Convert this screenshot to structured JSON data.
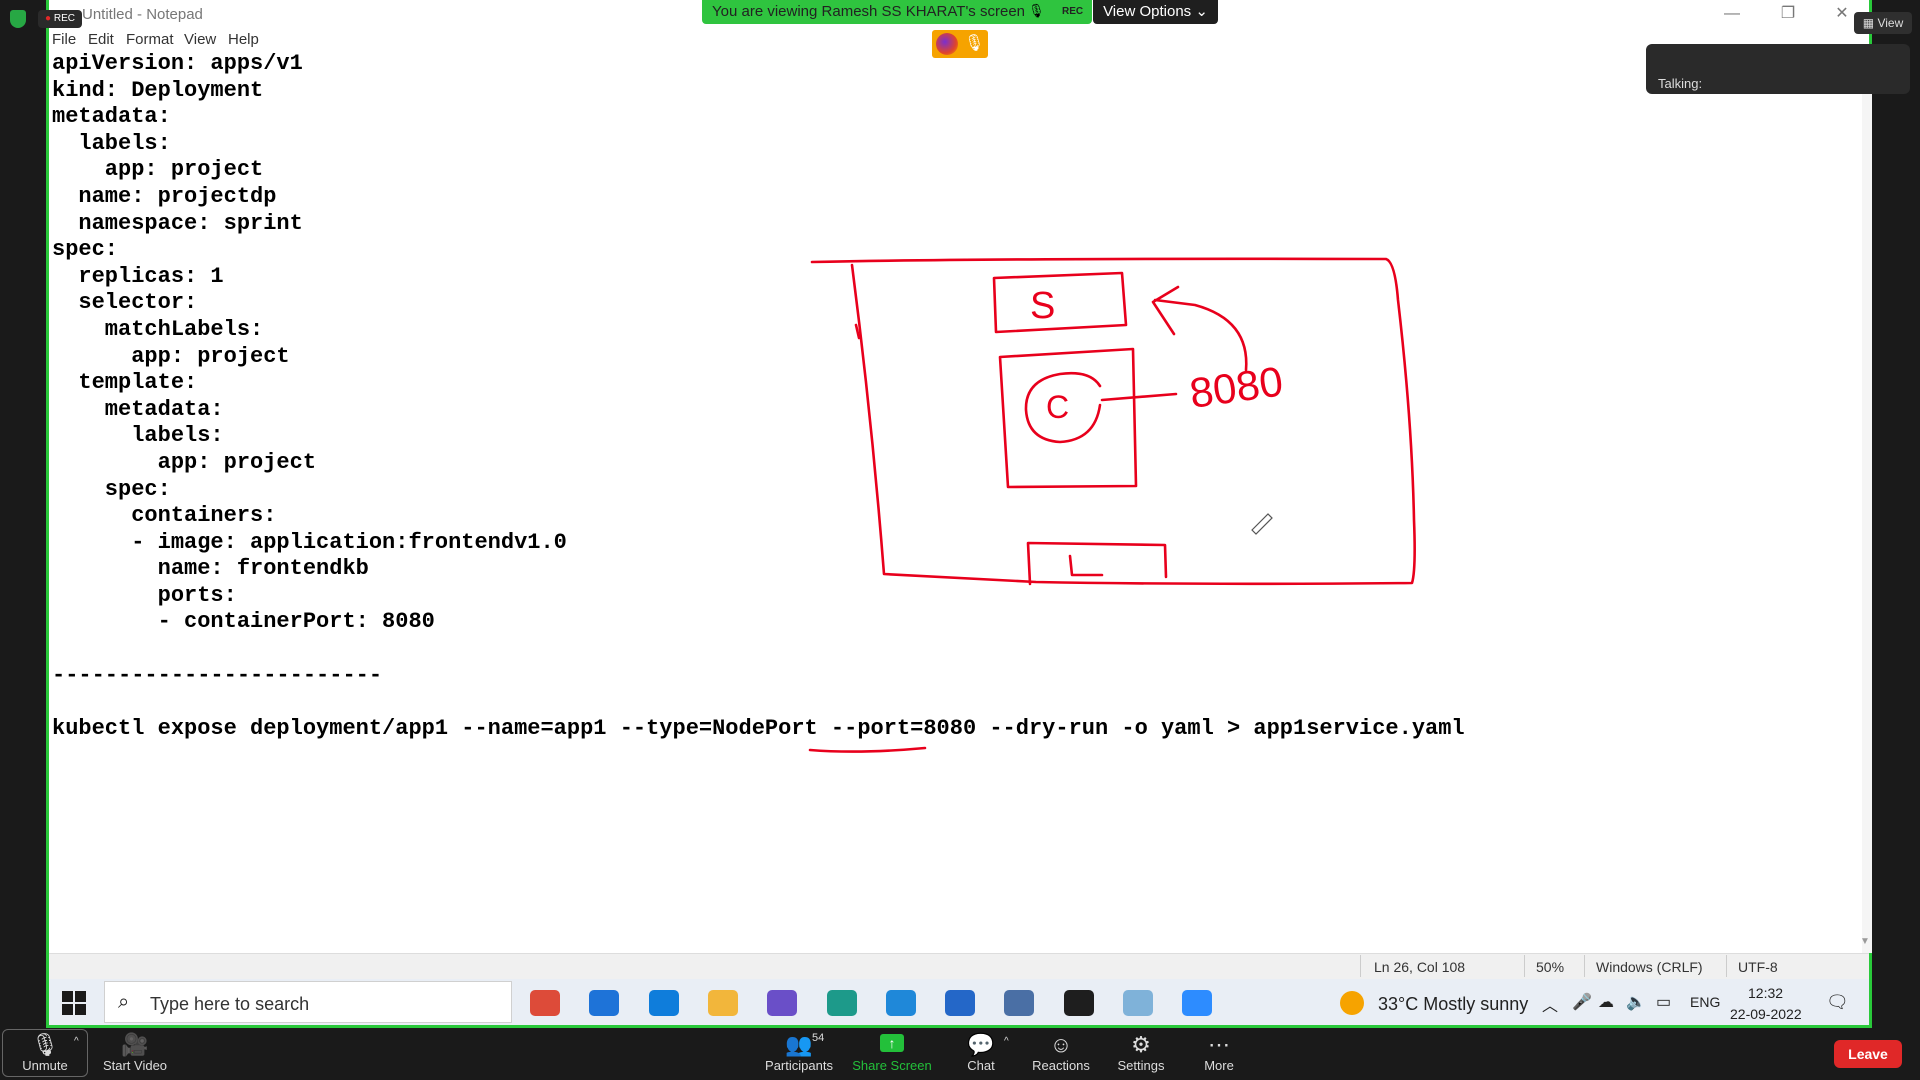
{
  "notepad": {
    "title": "Untitled - Notepad",
    "menu": [
      "File",
      "Edit",
      "Format",
      "View",
      "Help"
    ],
    "code_lines": [
      "apiVersion: apps/v1",
      "kind: Deployment",
      "metadata:",
      "  labels:",
      "    app: project",
      "  name: projectdp",
      "  namespace: sprint",
      "spec:",
      "  replicas: 1",
      "  selector:",
      "    matchLabels:",
      "      app: project",
      "  template:",
      "    metadata:",
      "      labels:",
      "        app: project",
      "    spec:",
      "      containers:",
      "      - image: application:frontendv1.0",
      "        name: frontendkb",
      "        ports:",
      "        - containerPort: 8080",
      "",
      "-------------------------",
      "",
      "kubectl expose deployment/app1 --name=app1 --type=NodePort --port=8080 --dry-run -o yaml > app1service.yaml"
    ],
    "status": {
      "position": "Ln 26, Col 108",
      "zoom": "50%",
      "line_ending": "Windows (CRLF)",
      "encoding": "UTF-8"
    }
  },
  "annotation": {
    "color": "#e8001c",
    "box_letters": [
      "S",
      "C"
    ],
    "port_label": "8080"
  },
  "taskbar": {
    "search_placeholder": "Type here to search",
    "apps": [
      {
        "name": "chrome-icon",
        "color": "#dd4b39"
      },
      {
        "name": "mail-icon",
        "color": "#1e73d8"
      },
      {
        "name": "edge-icon",
        "color": "#0f7ddb"
      },
      {
        "name": "file-explorer-icon",
        "color": "#f2b63b"
      },
      {
        "name": "github-desktop-icon",
        "color": "#6a4fc8"
      },
      {
        "name": "edge-beta-icon",
        "color": "#1d9a8a"
      },
      {
        "name": "app-blue-icon",
        "color": "#1f88d9"
      },
      {
        "name": "x-app-icon",
        "color": "#2467c8"
      },
      {
        "name": "network-icon",
        "color": "#4a6fa5"
      },
      {
        "name": "terminal-icon",
        "color": "#1e1e1e"
      },
      {
        "name": "notepad-icon",
        "color": "#7fb2d9"
      },
      {
        "name": "zoom-icon",
        "color": "#2d8cff"
      }
    ],
    "weather": "33°C  Mostly sunny",
    "language": "ENG",
    "time": "12:32",
    "date": "22-09-2022"
  },
  "zoom": {
    "banner_text": "You are viewing Ramesh SS KHARAT's screen",
    "banner_rec": "REC",
    "view_options": "View Options",
    "rec_badge": "REC",
    "talking": "Talking:",
    "view_label": "View",
    "toolbar": {
      "unmute": "Unmute",
      "start_video": "Start Video",
      "participants": "Participants",
      "participants_count": "54",
      "share_screen": "Share Screen",
      "chat": "Chat",
      "reactions": "Reactions",
      "settings": "Settings",
      "more": "More",
      "leave": "Leave"
    }
  }
}
